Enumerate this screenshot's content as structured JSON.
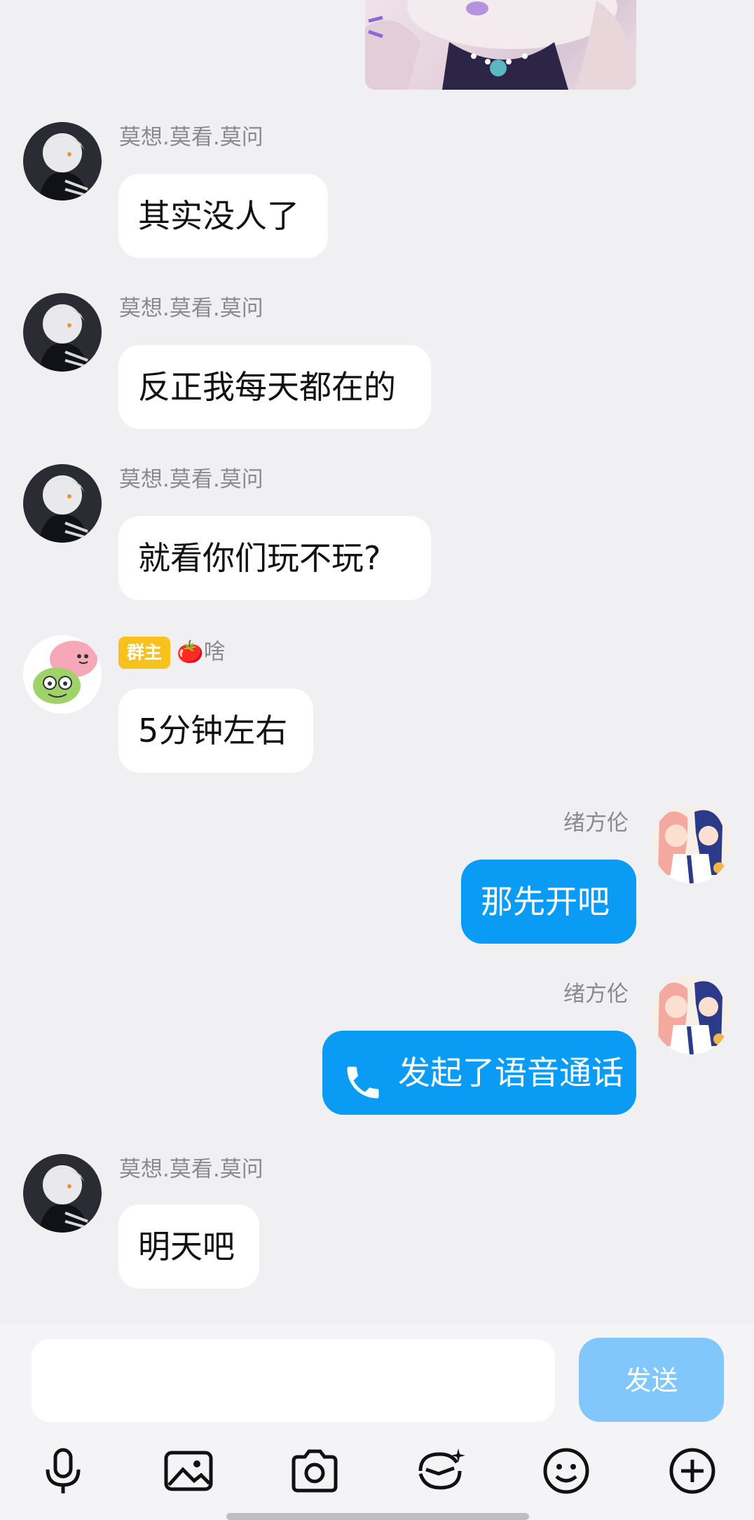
{
  "messages": [
    {
      "sender": "莫想.莫看.莫问",
      "text": "其实没人了"
    },
    {
      "sender": "莫想.莫看.莫问",
      "text": "反正我每天都在的"
    },
    {
      "sender": "莫想.莫看.莫问",
      "text": "就看你们玩不玩?"
    },
    {
      "badge": "群主",
      "sender_emoji": "🍅",
      "sender": "啥",
      "text": "5分钟左右"
    },
    {
      "sender": "绪方伦",
      "text": "那先开吧"
    },
    {
      "sender": "绪方伦",
      "text": "发起了语音通话",
      "icon": "phone-icon"
    },
    {
      "sender": "莫想.莫看.莫问",
      "text": "明天吧"
    }
  ],
  "input": {
    "value": "",
    "placeholder": ""
  },
  "send_label": "发送",
  "toolbar": [
    "mic-icon",
    "image-icon",
    "camera-icon",
    "sticker-icon",
    "emoji-icon",
    "plus-icon"
  ],
  "colors": {
    "bubble_self": "#0a9cf5",
    "send_disabled": "#82c7fb",
    "badge": "#f8c21c",
    "background": "#f0f0f3"
  }
}
